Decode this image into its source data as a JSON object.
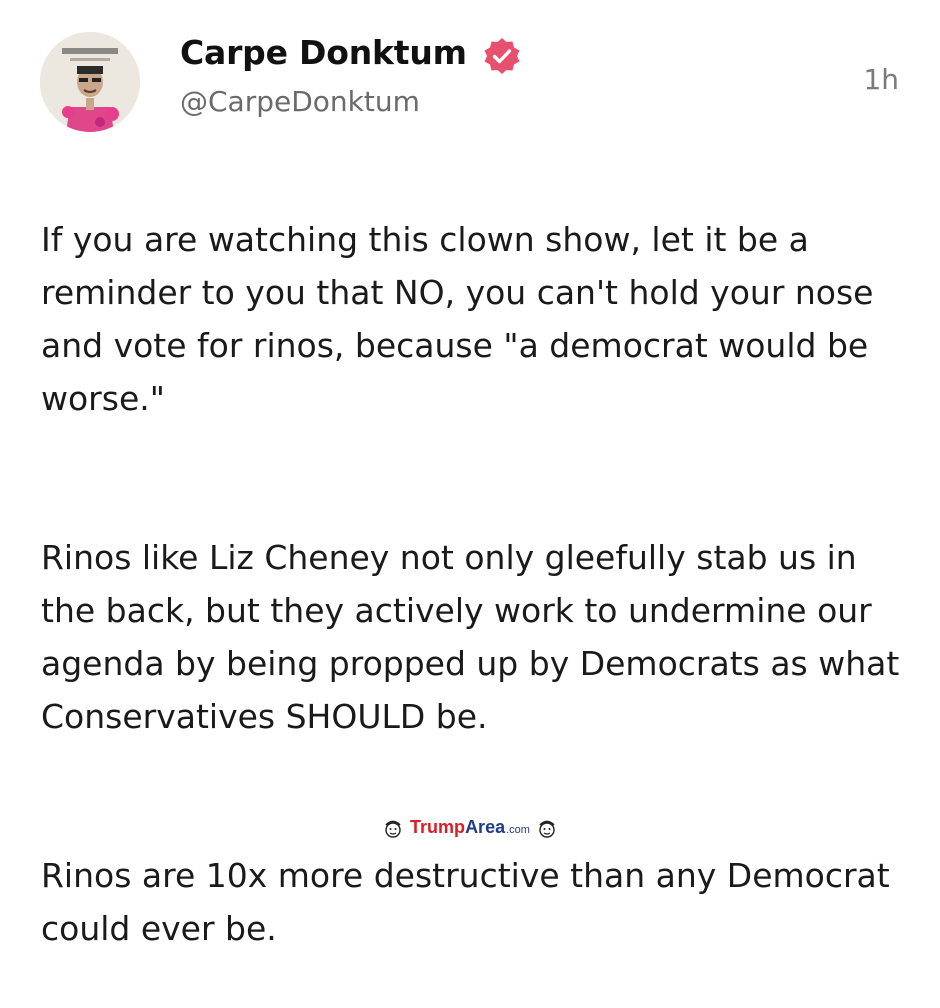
{
  "post": {
    "author": {
      "display_name": "Carpe Donktum",
      "handle": "@CarpeDonktum",
      "verified": true,
      "avatar_icon": "caricature-avatar",
      "verified_badge_color": "#e8516e"
    },
    "timestamp": "1h",
    "paragraphs": [
      "If you are watching this clown show, let it be a reminder to you that NO, you can't hold your nose and vote for rinos, because \"a democrat would be worse.\"",
      "Rinos like Liz Cheney not only gleefully stab us in the back, but they actively work to undermine our agenda by being propped up by Democrats as what Conservatives SHOULD be.",
      "Rinos are 10x more destructive than any Democrat could ever be."
    ]
  },
  "watermark": {
    "part1": "Trump",
    "part2": "Area",
    "part3": ".com",
    "icon": "cartoon-face-icon",
    "colors": {
      "trump": "#d81f26",
      "area": "#1f3c88"
    }
  }
}
